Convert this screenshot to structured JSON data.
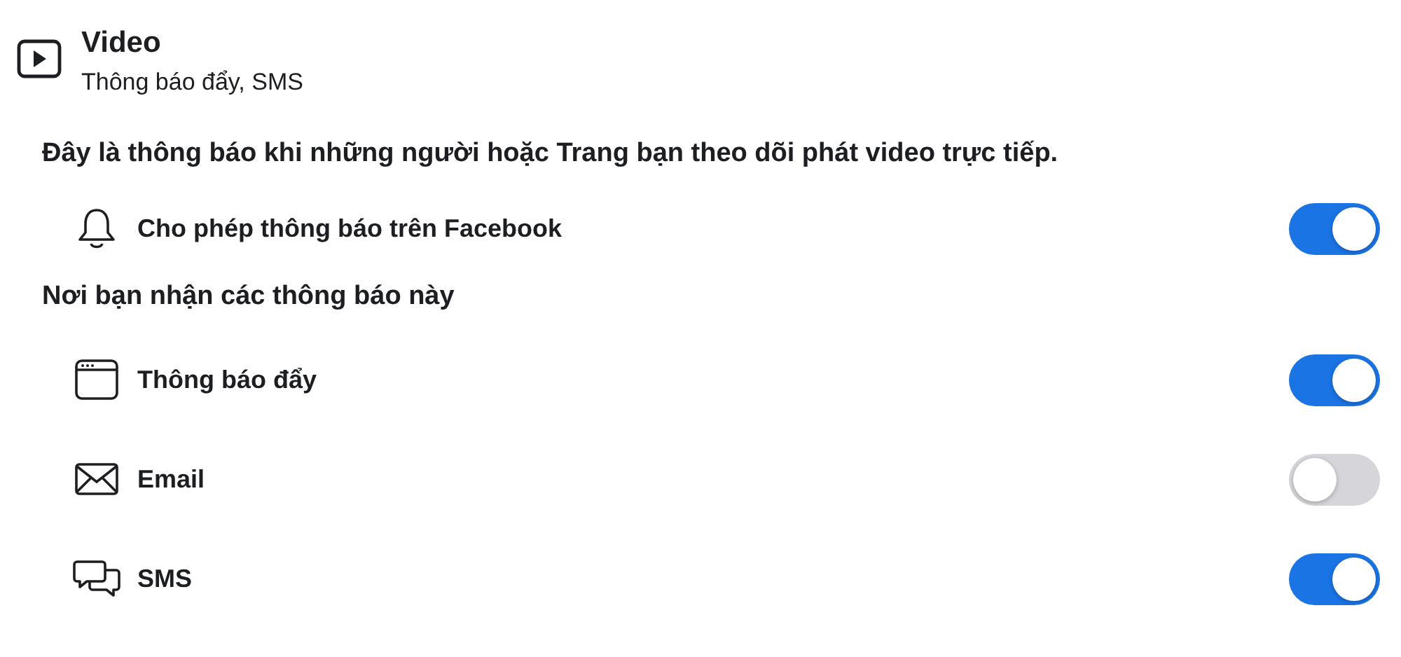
{
  "header": {
    "title": "Video",
    "subtitle": "Thông báo đẩy, SMS"
  },
  "description": "Đây là thông báo khi những người hoặc Trang bạn theo dõi phát video trực tiếp.",
  "permission": {
    "label": "Cho phép thông báo trên Facebook",
    "on": true
  },
  "section_title": "Nơi bạn nhận các thông báo này",
  "channels": [
    {
      "kind": "push",
      "label": "Thông báo đẩy",
      "on": true
    },
    {
      "kind": "email",
      "label": "Email",
      "on": false
    },
    {
      "kind": "sms",
      "label": "SMS",
      "on": true
    }
  ]
}
